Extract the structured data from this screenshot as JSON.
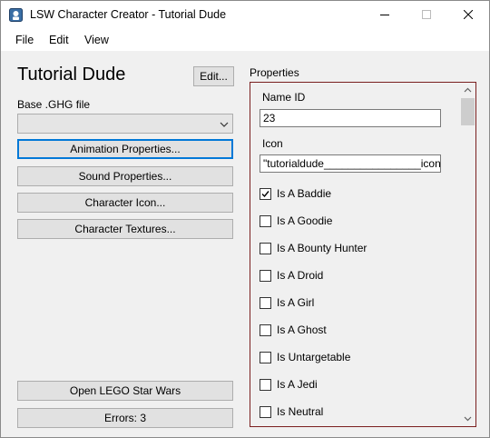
{
  "window": {
    "title": "LSW Character Creator - Tutorial Dude"
  },
  "menu": {
    "items": [
      "File",
      "Edit",
      "View"
    ]
  },
  "character": {
    "name": "Tutorial Dude",
    "edit_label": "Edit...",
    "base_ghg_label": "Base .GHG file",
    "base_ghg_value": ""
  },
  "left_buttons": {
    "animation": "Animation Properties...",
    "sound": "Sound Properties...",
    "icon": "Character Icon...",
    "textures": "Character Textures..."
  },
  "bottom_buttons": {
    "open_game": "Open LEGO Star Wars",
    "errors": "Errors: 3"
  },
  "properties": {
    "title": "Properties",
    "name_id_label": "Name ID",
    "name_id_value": "23",
    "icon_label": "Icon",
    "icon_value": "\"tutorialdude________________icon\"",
    "checkboxes": [
      {
        "label": "Is A Baddie",
        "checked": true
      },
      {
        "label": "Is A Goodie",
        "checked": false
      },
      {
        "label": "Is A Bounty Hunter",
        "checked": false
      },
      {
        "label": "Is A Droid",
        "checked": false
      },
      {
        "label": "Is A Girl",
        "checked": false
      },
      {
        "label": "Is A Ghost",
        "checked": false
      },
      {
        "label": "Is Untargetable",
        "checked": false
      },
      {
        "label": "Is A Jedi",
        "checked": false
      },
      {
        "label": "Is Neutral",
        "checked": false
      }
    ]
  },
  "colors": {
    "group_border": "#7a1f1f",
    "focus_border": "#0078d7"
  }
}
